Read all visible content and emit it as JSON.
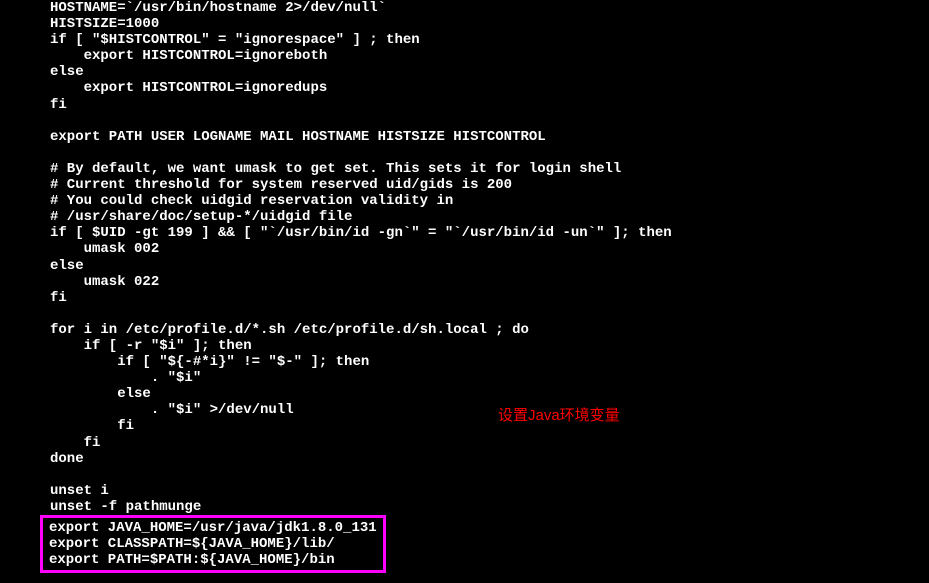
{
  "terminal": {
    "lines": [
      "HOSTNAME=`/usr/bin/hostname 2>/dev/null`",
      "HISTSIZE=1000",
      "if [ \"$HISTCONTROL\" = \"ignorespace\" ] ; then",
      "    export HISTCONTROL=ignoreboth",
      "else",
      "    export HISTCONTROL=ignoredups",
      "fi",
      "",
      "export PATH USER LOGNAME MAIL HOSTNAME HISTSIZE HISTCONTROL",
      "",
      "# By default, we want umask to get set. This sets it for login shell",
      "# Current threshold for system reserved uid/gids is 200",
      "# You could check uidgid reservation validity in",
      "# /usr/share/doc/setup-*/uidgid file",
      "if [ $UID -gt 199 ] && [ \"`/usr/bin/id -gn`\" = \"`/usr/bin/id -un`\" ]; then",
      "    umask 002",
      "else",
      "    umask 022",
      "fi",
      "",
      "for i in /etc/profile.d/*.sh /etc/profile.d/sh.local ; do",
      "    if [ -r \"$i\" ]; then",
      "        if [ \"${-#*i}\" != \"$-\" ]; then",
      "            . \"$i\"",
      "        else",
      "            . \"$i\" >/dev/null",
      "        fi",
      "    fi",
      "done",
      "",
      "unset i",
      "unset -f pathmunge"
    ],
    "highlighted_lines": [
      "export JAVA_HOME=/usr/java/jdk1.8.0_131",
      "export CLASSPATH=${JAVA_HOME}/lib/",
      "export PATH=$PATH:${JAVA_HOME}/bin"
    ]
  },
  "annotation": {
    "text": "设置Java环境变量"
  }
}
